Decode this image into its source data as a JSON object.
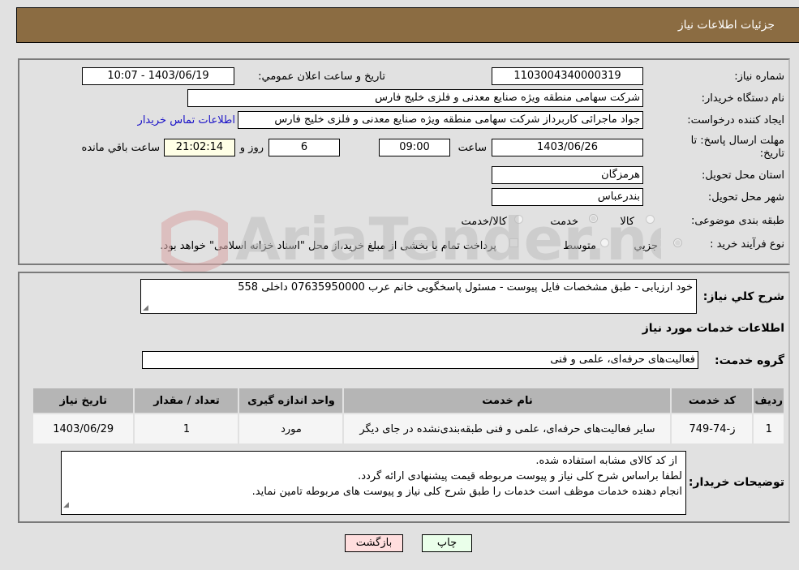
{
  "header": {
    "title": "جزئیات اطلاعات نیاز"
  },
  "details": {
    "need_number_label": "شماره نیاز:",
    "need_number": "1103004340000319",
    "announce_label": "تاریخ و ساعت اعلان عمومي:",
    "announce_value": "1403/06/19 - 10:07",
    "buyer_org_label": "نام دستگاه خریدار:",
    "buyer_org": "شرکت سهامی منطقه ویژه صنایع معدنی و فلزی خلیج فارس",
    "creator_label": "ایجاد کننده درخواست:",
    "creator": "جواد ماجرائی کاربرداز شرکت سهامی منطقه ویژه صنایع معدنی و فلزی خلیج فارس",
    "contact_link": "اطلاعات تماس خریدار",
    "deadline_label_1": "مهلت ارسال پاسخ: تا",
    "deadline_label_2": "تاریخ:",
    "deadline_date": "1403/06/26",
    "time_label": "ساعت",
    "deadline_time": "09:00",
    "days_value": "6",
    "days_label": "روز و",
    "remaining_time": "21:02:14",
    "remaining_label": "ساعت باقي مانده",
    "province_label": "استان محل تحویل:",
    "province": "هرمزگان",
    "city_label": "شهر محل تحویل:",
    "city": "بندرعباس",
    "category_label": "طبقه بندی موضوعی:",
    "category_options": [
      {
        "label": "کالا",
        "checked": false
      },
      {
        "label": "خدمت",
        "checked": true
      },
      {
        "label": "کالا/خدمت",
        "checked": false
      }
    ],
    "process_label": "نوع فرآیند خرید :",
    "process_options": [
      {
        "label": "جزيي",
        "checked": true
      },
      {
        "label": "متوسط",
        "checked": false
      }
    ],
    "treasury_note": "پرداخت تمام یا بخشی از مبلغ خرید،از محل \"اسناد خزانه اسلامی\" خواهد بود."
  },
  "description": {
    "label": "شرح کلي نياز:",
    "value": "خود ارزیابی - طبق مشخصات فایل پیوست - مسئول پاسخگویی خانم عرب 07635950000 داخلی 558"
  },
  "services": {
    "section_title": "اطلاعات خدمات مورد نیاز",
    "group_label": "گروه خدمت:",
    "group_value": "فعالیت‌های حرفه‌ای، علمی و فنی",
    "table": {
      "headers": [
        "ردیف",
        "کد خدمت",
        "نام خدمت",
        "واحد اندازه گیری",
        "تعداد / مقدار",
        "تاریخ نیاز"
      ],
      "rows": [
        [
          "1",
          "ز-74-749",
          "سایر فعالیت‌های حرفه‌ای، علمی و فنی طبقه‌بندی‌نشده در جای دیگر",
          "مورد",
          "1",
          "1403/06/29"
        ]
      ]
    }
  },
  "buyer_notes": {
    "label": "توضیحات خریدار:",
    "lines": [
      "از کد کالای مشابه استفاده شده.",
      "لطفا براساس شرح کلی نیاز و پیوست مربوطه قیمت پیشنهادی ارائه گردد.",
      "انجام دهنده خدمات موظف است خدمات را طبق شرح کلی نیاز و پیوست های مربوطه تامین نماید."
    ]
  },
  "buttons": {
    "print": "چاپ",
    "back": "بازگشت"
  },
  "colors": {
    "header_bg": "#8b6c42",
    "print_bg": "#eaffea",
    "back_bg": "#ffdede",
    "link": "#1a12c8"
  },
  "watermark": {
    "text": "AriaTender.neT"
  }
}
